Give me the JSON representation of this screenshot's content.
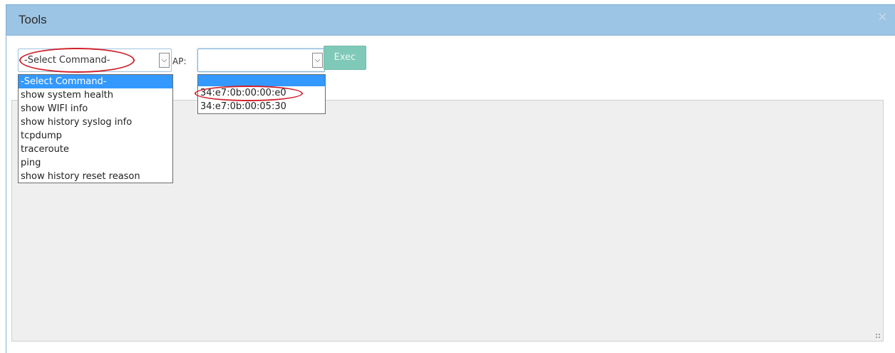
{
  "dialog": {
    "title": "Tools",
    "close_label": "×"
  },
  "command_select": {
    "selected": "-Select Command-",
    "options": [
      "-Select Command-",
      "show system health",
      "show WIFI info",
      "show history syslog info",
      "tcpdump",
      "traceroute",
      "ping",
      "show history reset reason"
    ]
  },
  "ap_select": {
    "label": "AP:",
    "selected": "",
    "options": [
      "",
      "34:e7:0b:00:00:e0",
      "34:e7:0b:00:05:30"
    ]
  },
  "exec_button": {
    "label": "Exec"
  },
  "output": {
    "text": ""
  },
  "annotation_color": "#d0202a"
}
